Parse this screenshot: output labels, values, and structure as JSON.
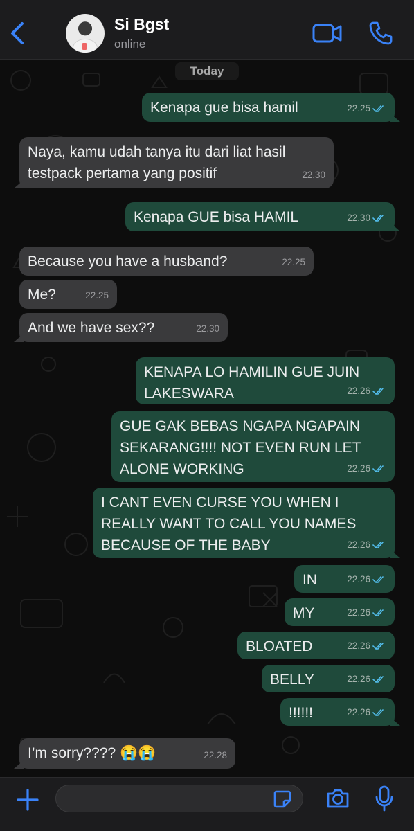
{
  "header": {
    "contact_name": "Si Bgst",
    "status": "online",
    "back_icon": "chevron-left-icon",
    "video_icon": "video-camera-icon",
    "call_icon": "phone-icon"
  },
  "chat": {
    "day_label": "Today",
    "messages": [
      {
        "dir": "out",
        "text": "Kenapa gue bisa hamil",
        "time": "22.25",
        "read": true
      },
      {
        "dir": "in",
        "text": "Naya, kamu udah tanya itu dari liat hasil testpack pertama yang positif",
        "time": "22.30"
      },
      {
        "dir": "out",
        "text": "Kenapa GUE bisa HAMIL",
        "time": "22.30",
        "read": true
      },
      {
        "dir": "in",
        "text": "Because you have a husband?",
        "time": "22.25"
      },
      {
        "dir": "in",
        "text": "Me?",
        "time": "22.25"
      },
      {
        "dir": "in",
        "text": "And we have sex??",
        "time": "22.30"
      },
      {
        "dir": "out",
        "text": "KENAPA LO HAMILIN GUE JUIN LAKESWARA",
        "time": "22.26",
        "read": true
      },
      {
        "dir": "out",
        "text": "GUE GAK BEBAS NGAPA NGAPAIN SEKARANG!!!! NOT EVEN RUN LET ALONE WORKING",
        "time": "22.26",
        "read": true
      },
      {
        "dir": "out",
        "text": "I CANT EVEN CURSE YOU WHEN I REALLY WANT TO CALL YOU NAMES BECAUSE OF THE BABY",
        "time": "22.26",
        "read": true
      },
      {
        "dir": "out",
        "text": "IN",
        "time": "22.26",
        "read": true
      },
      {
        "dir": "out",
        "text": "MY",
        "time": "22.26",
        "read": true
      },
      {
        "dir": "out",
        "text": "BLOATED",
        "time": "22.26",
        "read": true
      },
      {
        "dir": "out",
        "text": "BELLY",
        "time": "22.26",
        "read": true
      },
      {
        "dir": "out",
        "text": "!!!!!!",
        "time": "22.26",
        "read": true
      },
      {
        "dir": "in",
        "text": "I’m sorry???? 😭😭",
        "time": "22.28"
      }
    ]
  },
  "composer": {
    "input_value": "",
    "plus_icon": "plus-icon",
    "sticker_icon": "sticker-icon",
    "camera_icon": "camera-icon",
    "mic_icon": "microphone-icon"
  },
  "colors": {
    "accent": "#3a82f7",
    "outgoing_bubble": "#1f4a3b",
    "incoming_bubble": "#3a3a3c",
    "read_ticks": "#53bdeb"
  }
}
